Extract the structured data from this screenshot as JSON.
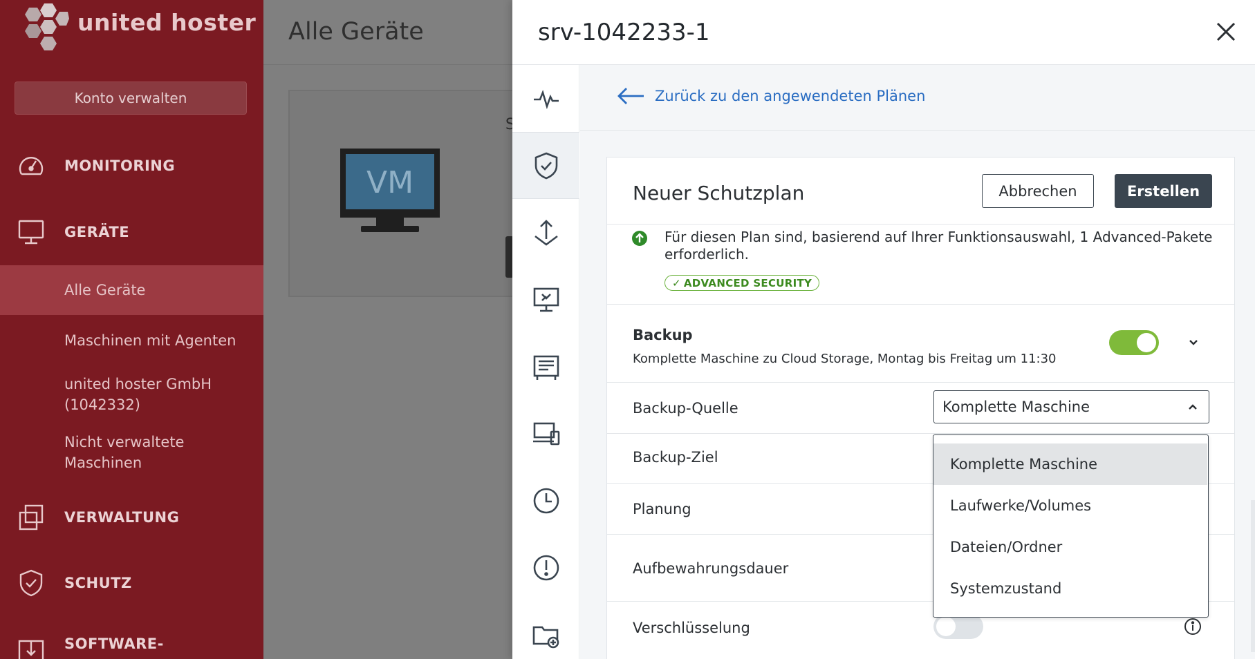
{
  "brand": {
    "name": "united hoster",
    "color": "#7b1a22"
  },
  "sidebar": {
    "account_button": "Konto verwalten",
    "nav": [
      {
        "label": "MONITORING",
        "icon": "speedometer-icon"
      },
      {
        "label": "GERÄTE",
        "icon": "monitor-icon"
      },
      {
        "label": "VERWALTUNG",
        "icon": "layers-icon"
      },
      {
        "label": "SCHUTZ",
        "icon": "shield-icon"
      },
      {
        "label": "SOFTWARE-",
        "icon": "software-icon"
      }
    ],
    "sub_items": [
      {
        "label": "Alle Geräte",
        "active": true
      },
      {
        "label": "Maschinen mit Agenten"
      },
      {
        "label": "united hoster GmbH (1042332)"
      },
      {
        "label": "Nicht verwaltete Maschinen"
      }
    ]
  },
  "main": {
    "title": "Alle Geräte",
    "device_icon_label": "VM",
    "fragment": "S"
  },
  "panel": {
    "title": "srv-1042233-1",
    "back_link": "Zurück zu den angewendeten Plänen",
    "rail_icons": [
      "activity-icon",
      "shield-check-icon",
      "recovery-icon",
      "remote-desktop-icon",
      "inventory-icon",
      "devices-icon",
      "clock-icon",
      "alert-icon",
      "folder-add-icon"
    ],
    "plan": {
      "title": "Neuer Schutzplan",
      "cancel": "Abbrechen",
      "create": "Erstellen",
      "notice": "Für diesen Plan sind, basierend auf Ihrer Funktionsauswahl, 1 Advanced-Pakete erforderlich.",
      "badge": "ADVANCED SECURITY",
      "backup": {
        "title": "Backup",
        "description": "Komplette Maschine zu Cloud Storage, Montag bis Freitag um 11:30",
        "enabled": true
      },
      "rows": [
        {
          "label": "Backup-Quelle",
          "value": "Komplette Maschine"
        },
        {
          "label": "Backup-Ziel"
        },
        {
          "label": "Planung"
        },
        {
          "label": "Aufbewahrungsdauer"
        },
        {
          "label": "Verschlüsselung",
          "enabled": false
        }
      ],
      "dropdown_options": [
        "Komplette Maschine",
        "Laufwerke/Volumes",
        "Dateien/Ordner",
        "Systemzustand"
      ],
      "dropdown_highlighted": "Komplette Maschine"
    }
  },
  "colors": {
    "accent_blue": "#2a6dc2",
    "toggle_green": "#7fba3a",
    "badge_green": "#3c8a1f",
    "dark_button": "#3a4550"
  }
}
